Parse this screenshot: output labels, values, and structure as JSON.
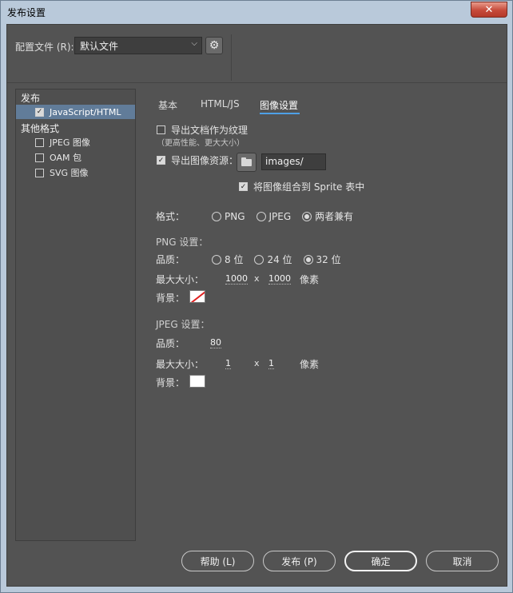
{
  "window": {
    "title": "发布设置",
    "close_glyph": "✕"
  },
  "profile": {
    "label": "配置文件 (R):",
    "value": "默认文件",
    "chevron": "⌵",
    "gear_glyph": "⚙"
  },
  "tree": {
    "publish_group": "发布",
    "publish_items": [
      {
        "label": "JavaScript/HTML",
        "checked": true,
        "selected": true
      }
    ],
    "other_group": "其他格式",
    "other_items": [
      {
        "label": "JPEG 图像",
        "checked": false
      },
      {
        "label": "OAM 包",
        "checked": false
      },
      {
        "label": "SVG 图像",
        "checked": false
      }
    ]
  },
  "tabs": [
    {
      "label": "基本"
    },
    {
      "label": "HTML/JS"
    },
    {
      "label": "图像设置",
      "active": true
    }
  ],
  "image_settings": {
    "export_as_texture": {
      "label": "导出文档作为纹理",
      "checked": false,
      "hint": "（更高性能、更大大小）"
    },
    "export_assets": {
      "label": "导出图像资源：",
      "checked": true,
      "path": "images/"
    },
    "combine_sprite": {
      "label": "将图像组合到 Sprite 表中",
      "checked": true
    },
    "format": {
      "label": "格式：",
      "options": [
        "PNG",
        "JPEG",
        "两者兼有"
      ],
      "selected": "两者兼有"
    },
    "png": {
      "heading": "PNG 设置：",
      "quality_label": "品质：",
      "quality_options": [
        "8 位",
        "24 位",
        "32 位"
      ],
      "quality_selected": "32 位",
      "max_size_label": "最大大小：",
      "width": "1000",
      "x": "x",
      "height": "1000",
      "unit": "像素",
      "bg_label": "背景："
    },
    "jpeg": {
      "heading": "JPEG 设置：",
      "quality_label": "品质：",
      "quality": "80",
      "max_size_label": "最大大小：",
      "width": "1",
      "x": "x",
      "height": "1",
      "unit": "像素",
      "bg_label": "背景："
    }
  },
  "buttons": {
    "help": "帮助 (L)",
    "publish": "发布 (P)",
    "ok": "确定",
    "cancel": "取消"
  },
  "colors": {
    "accent": "#4ea0e6",
    "selection": "#617c99",
    "panel": "#535353"
  }
}
